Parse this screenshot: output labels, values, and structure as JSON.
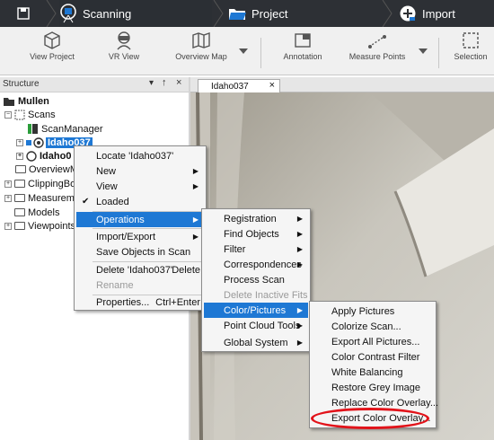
{
  "ribbon": {
    "tabs": [
      {
        "label": "Scanning",
        "icon": "scanner-icon"
      },
      {
        "label": "Project",
        "icon": "folder-icon"
      },
      {
        "label": "Import",
        "icon": "plus-circle-icon"
      }
    ],
    "home_icon": "save-icon"
  },
  "toolbar": {
    "view_project": "View Project",
    "vr_view": "VR View",
    "overview_map": "Overview Map",
    "annotation": "Annotation",
    "measure_points": "Measure Points",
    "selection": "Selection"
  },
  "structure": {
    "title": "Structure",
    "pin": "&#x2193;",
    "tree": {
      "root": "Mullen",
      "scans": "Scans",
      "scan_manager": "ScanManager",
      "selected_scan": "Idaho037",
      "next_scan": "Idaho0",
      "overview": "OverviewM",
      "clipping": "ClippingBo",
      "measure": "Measurem",
      "models": "Models",
      "viewpoints": "Viewpoints"
    }
  },
  "view": {
    "tab_label": "Idaho037",
    "tab_close": "×"
  },
  "context_menu": {
    "items": [
      {
        "label": "Locate 'Idaho037'"
      },
      {
        "label": "New",
        "submenu": true
      },
      {
        "label": "View",
        "submenu": true
      },
      {
        "label": "Loaded",
        "checked": true
      },
      {
        "label": "Operations",
        "submenu": true,
        "highlighted": true
      },
      {
        "label": "Import/Export",
        "submenu": true
      },
      {
        "label": "Save Objects in Scan"
      },
      {
        "label": "Delete 'Idaho037'",
        "shortcut": "Delete"
      },
      {
        "label": "Rename",
        "disabled": true
      },
      {
        "label": "Properties...",
        "shortcut": "Ctrl+Enter"
      }
    ]
  },
  "operations_menu": {
    "items": [
      {
        "label": "Registration",
        "submenu": true
      },
      {
        "label": "Find Objects",
        "submenu": true
      },
      {
        "label": "Filter",
        "submenu": true
      },
      {
        "label": "Correspondences",
        "submenu": true
      },
      {
        "label": "Process Scan"
      },
      {
        "label": "Delete Inactive Fits",
        "disabled": true
      },
      {
        "label": "Color/Pictures",
        "submenu": true,
        "highlighted": true
      },
      {
        "label": "Point Cloud Tools",
        "submenu": true
      },
      {
        "label": "Global System",
        "submenu": true
      }
    ]
  },
  "color_menu": {
    "items": [
      {
        "label": "Apply Pictures"
      },
      {
        "label": "Colorize Scan..."
      },
      {
        "label": "Export All Pictures..."
      },
      {
        "label": "Color Contrast Filter"
      },
      {
        "label": "White Balancing"
      },
      {
        "label": "Restore Grey Image"
      },
      {
        "label": "Replace Color Overlay..."
      },
      {
        "label": "Export Color Overlay..."
      }
    ]
  },
  "colors": {
    "ribbon_bg": "#2d3035",
    "highlight": "#1e78d4",
    "callout": "#e2131a"
  }
}
